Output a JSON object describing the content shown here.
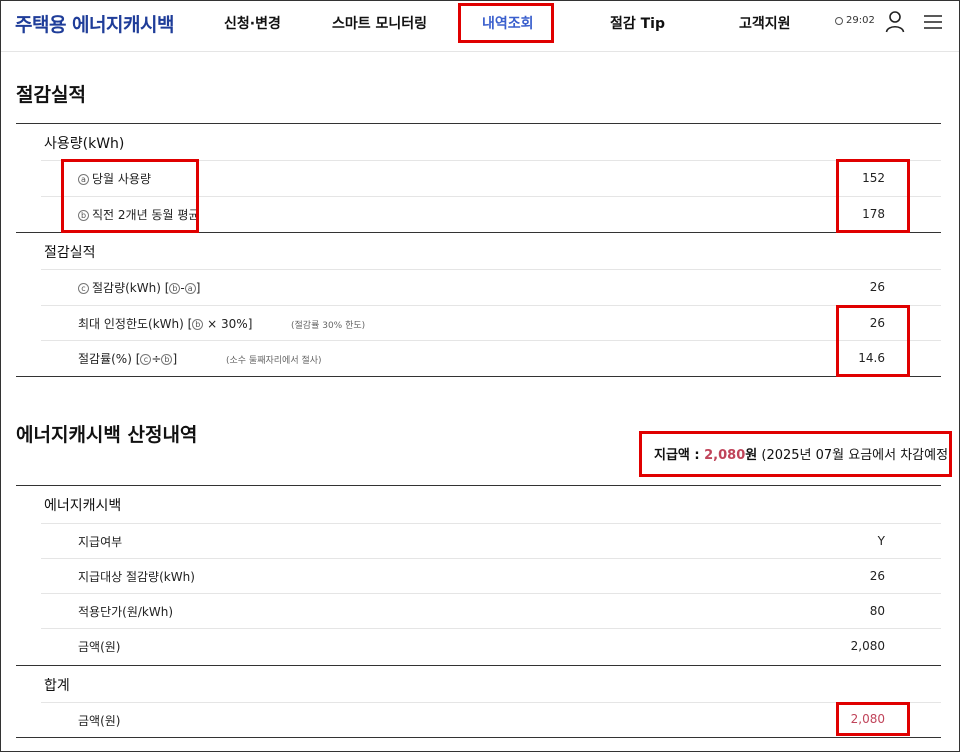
{
  "header": {
    "logo": "주택용 에너지캐시백",
    "nav": [
      "신청·변경",
      "스마트 모니터링",
      "내역조회",
      "절감 Tip",
      "고객지원"
    ],
    "timer": "29:02"
  },
  "savings": {
    "title": "절감실적",
    "usage_group": "사용량(kWh)",
    "usage_rows": [
      {
        "mark": "ⓐ",
        "label": "당월 사용량",
        "value": "152"
      },
      {
        "mark": "ⓑ",
        "label": "직전 2개년 동월 평균",
        "value": "178"
      }
    ],
    "perf_group": "절감실적",
    "perf_row1": {
      "mark": "ⓒ",
      "label": "절감량(kWh) [",
      "m1": "ⓑ",
      "sep": "-",
      "m2": "ⓐ",
      "end": "]",
      "value": "26"
    },
    "perf_row2": {
      "label": "최대 인정한도(kWh) [",
      "m1": "ⓑ",
      "rest": " × 30%]",
      "note": "(절감률 30% 한도)",
      "value": "26"
    },
    "perf_row3": {
      "label": "절감률(%) [",
      "m1": "ⓒ",
      "sep": "÷",
      "m2": "ⓑ",
      "end": "]",
      "note": "(소수 둘째자리에서 절사)",
      "value": "14.6"
    }
  },
  "cashback": {
    "title": "에너지캐시백 산정내역",
    "payment_label": "지급액 : ",
    "payment_amount": "2,080",
    "payment_unit": "원",
    "payment_note": " (2025년 07월 요금에서 차감예정)",
    "group": "에너지캐시백",
    "rows": [
      {
        "label": "지급여부",
        "value": "Y"
      },
      {
        "label": "지급대상 절감량(kWh)",
        "value": "26"
      },
      {
        "label": "적용단가(원/kWh)",
        "value": "80"
      },
      {
        "label": "금액(원)",
        "value": "2,080"
      }
    ],
    "total_group": "합계",
    "total_row": {
      "label": "금액(원)",
      "value": "2,080"
    }
  },
  "colors": {
    "logo": "#1f3d99",
    "active_nav": "#3a5fcd",
    "highlight": "#e00000",
    "amount": "#c0445a"
  }
}
